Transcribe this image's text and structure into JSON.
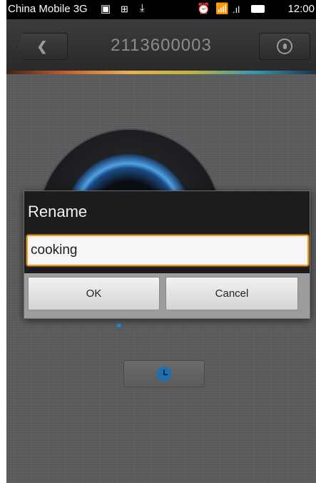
{
  "status_bar": {
    "carrier": "China Mobile 3G",
    "time": "12:00",
    "icons": [
      "image-icon",
      "grid-icon",
      "download-icon",
      "alarm-icon",
      "wifi-icon",
      "signal-icon",
      "battery-icon"
    ]
  },
  "header": {
    "title": "2113600003",
    "back_icon": "chevron-left-icon",
    "user_icon": "user-circle-icon"
  },
  "dialog": {
    "title": "Rename",
    "input_value": "cooking",
    "ok_label": "OK",
    "cancel_label": "Cancel",
    "accent_color": "#f39a1c"
  },
  "background": {
    "clock_button_icon": "clock-icon"
  }
}
